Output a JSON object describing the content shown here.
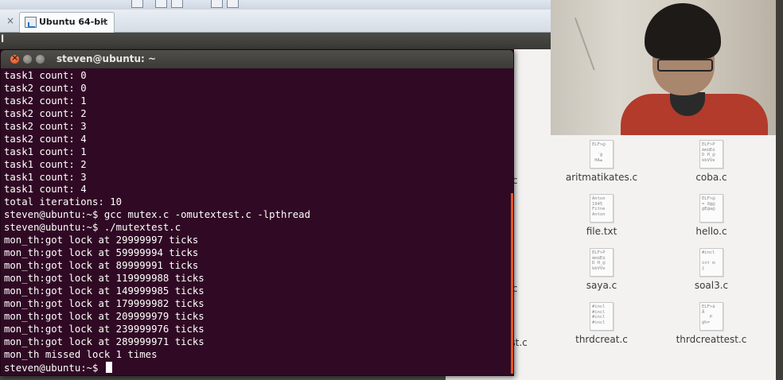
{
  "vmware": {
    "tab_label": "Ubuntu 64-bit",
    "tab_close": "×",
    "left_close": "×"
  },
  "guest_panel": {
    "char": "l"
  },
  "terminal": {
    "title": "steven@ubuntu: ~",
    "lines": [
      "task1 count: 0",
      "task2 count: 0",
      "task2 count: 1",
      "task2 count: 2",
      "task2 count: 3",
      "task2 count: 4",
      "task1 count: 1",
      "task1 count: 2",
      "task1 count: 3",
      "task1 count: 4",
      "total iterations: 10",
      "steven@ubuntu:~$ gcc mutex.c -omutextest.c -lpthread",
      "steven@ubuntu:~$ ./mutextest.c",
      "mon_th:got lock at 29999997 ticks",
      "mon_th:got lock at 59999994 ticks",
      "mon_th:got lock at 89999991 ticks",
      "mon_th:got lock at 119999988 ticks",
      "mon_th:got lock at 149999985 ticks",
      "mon_th:got lock at 179999982 ticks",
      "mon_th:got lock at 209999979 ticks",
      "mon_th:got lock at 239999976 ticks",
      "mon_th:got lock at 289999971 ticks",
      "mon_th missed lock 1 times"
    ],
    "prompt": "steven@ubuntu:~$ "
  },
  "files": {
    "partial": [
      ".c",
      "s",
      ".c",
      "est.c"
    ],
    "items": [
      {
        "name": "aritmatikates.c",
        "thumb": "ELF>@\n\n  `@\n HA±"
      },
      {
        "name": "coba.c",
        "thumb": "ELF>P\nèmüEü\nD H_@\nkbVVe"
      },
      {
        "name": "file.txt",
        "thumb": "Anton\n1945\nFitne\nAnton"
      },
      {
        "name": "hello.c",
        "thumb": "ELF>@\n= 0@@\n@E@a@"
      },
      {
        "name": "saya.c",
        "thumb": "ELF>P\nèmüEü\nD H_@\nkbVVe"
      },
      {
        "name": "soal3.c",
        "thumb": "#incl\n\nint m\n{"
      },
      {
        "name": "thrdcreat.c",
        "thumb": "#incl\n#incl\n#incl\n#incl"
      },
      {
        "name": "thrdcreattest.c",
        "thumb": "ELF>à\nÄ\n   P\n@%="
      }
    ]
  }
}
